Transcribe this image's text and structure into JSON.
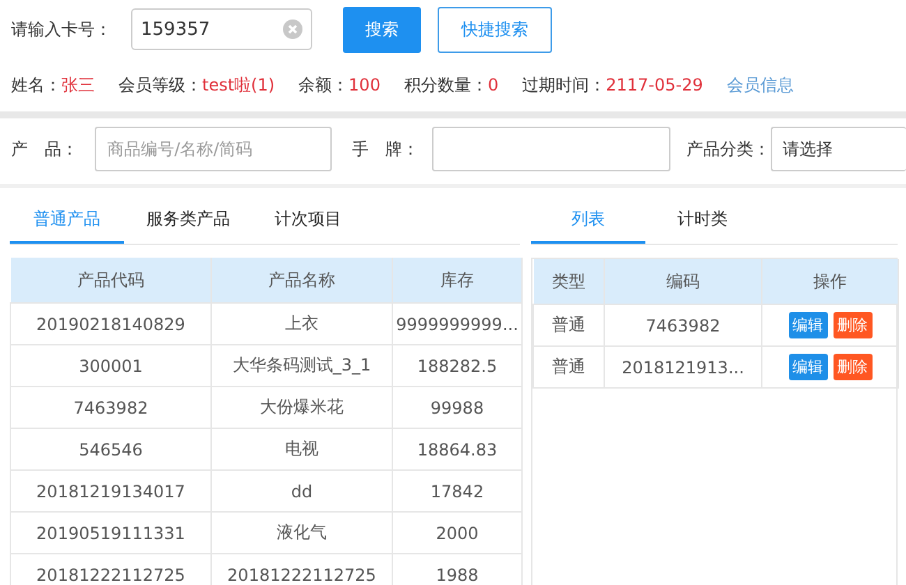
{
  "card_search": {
    "label": "请输入卡号：",
    "value": "159357",
    "search_button": "搜索",
    "quick_search_button": "快捷搜索"
  },
  "member_info": [
    {
      "label": "姓名：",
      "value": "张三"
    },
    {
      "label": "会员等级：",
      "value": "test啦(1)"
    },
    {
      "label": "余额：",
      "value": "100"
    },
    {
      "label": "积分数量：",
      "value": "0"
    },
    {
      "label": "过期时间：",
      "value": "2117-05-29"
    }
  ],
  "member_link": "会员信息",
  "filters": {
    "product_label": "产　品：",
    "product_placeholder": "商品编号/名称/简码",
    "tag_label": "手　牌：",
    "category_label": "产品分类：",
    "category_value": "请选择"
  },
  "left_tabs": [
    {
      "label": "普通产品",
      "selected": true
    },
    {
      "label": "服务类产品",
      "selected": false
    },
    {
      "label": "计次项目",
      "selected": false
    }
  ],
  "products": {
    "columns": [
      "产品代码",
      "产品名称",
      "库存"
    ],
    "rows": [
      [
        "20190218140829",
        "上衣",
        "9999999999..."
      ],
      [
        "300001",
        "大华条码测试_3_1",
        "188282.5"
      ],
      [
        "7463982",
        "大份爆米花",
        "99988"
      ],
      [
        "546546",
        "电视",
        "18864.83"
      ],
      [
        "20181219134017",
        "dd",
        "17842"
      ],
      [
        "20190519111331",
        "液化气",
        "2000"
      ],
      [
        "20181222112725",
        "20181222112725",
        "1988"
      ]
    ]
  },
  "right_tabs": [
    {
      "label": "列表",
      "selected": true
    },
    {
      "label": "计时类",
      "selected": false
    }
  ],
  "list": {
    "columns": [
      "类型",
      "编码",
      "操作"
    ],
    "rows": [
      {
        "type": "普通",
        "code": "7463982",
        "edit": "编辑",
        "delete": "删除"
      },
      {
        "type": "普通",
        "code": "2018121913...",
        "edit": "编辑",
        "delete": "删除"
      }
    ]
  }
}
